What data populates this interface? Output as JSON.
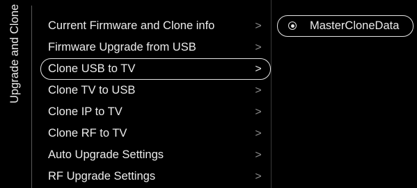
{
  "sidebar": {
    "title": "Upgrade and Clone"
  },
  "menu": {
    "items": [
      {
        "label": "Current Firmware and Clone info",
        "chevron": ">"
      },
      {
        "label": "Firmware Upgrade from USB",
        "chevron": ">"
      },
      {
        "label": "Clone USB to TV",
        "chevron": ">"
      },
      {
        "label": "Clone TV to USB",
        "chevron": ">"
      },
      {
        "label": "Clone IP to TV",
        "chevron": ">"
      },
      {
        "label": "Clone RF to TV",
        "chevron": ">"
      },
      {
        "label": "Auto Upgrade Settings",
        "chevron": ">"
      },
      {
        "label": "RF Upgrade Settings",
        "chevron": ">"
      }
    ],
    "selected_index": 2
  },
  "options": {
    "items": [
      {
        "label": "MasterCloneData",
        "selected": true
      }
    ]
  },
  "colors": {
    "background": "#000000",
    "text": "#ececec",
    "chevron": "#8c8c8c",
    "highlight_border": "#e6e6e6"
  }
}
